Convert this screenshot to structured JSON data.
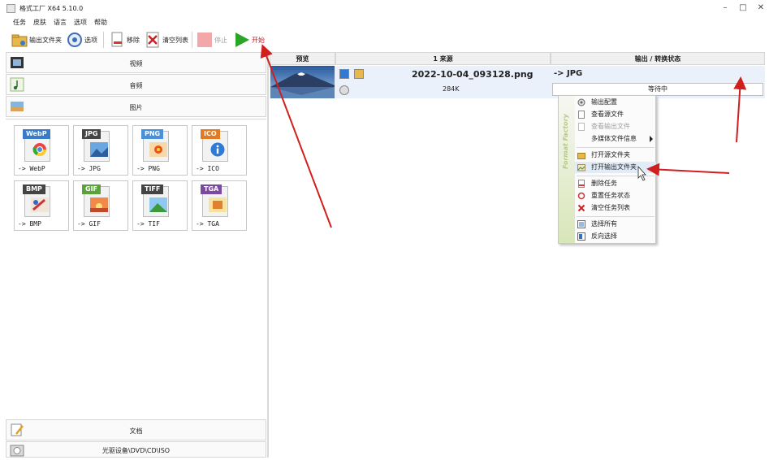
{
  "window": {
    "title": "格式工厂 X64 5.10.0"
  },
  "menu": [
    "任务",
    "皮肤",
    "语言",
    "选项",
    "帮助"
  ],
  "toolbar": {
    "output_folder": "输出文件夹",
    "options": "选项",
    "remove": "移除",
    "clear_list": "清空列表",
    "stop": "停止",
    "start": "开始"
  },
  "categories": {
    "video": "视频",
    "audio": "音频",
    "image": "图片",
    "document": "文档",
    "disc": "光驱设备\\DVD\\CD\\ISO"
  },
  "formats": [
    {
      "badge": "WebP",
      "label": "-> WebP",
      "color": "#3a7bc8"
    },
    {
      "badge": "JPG",
      "label": "-> JPG",
      "color": "#444444"
    },
    {
      "badge": "PNG",
      "label": "-> PNG",
      "color": "#4a90d9"
    },
    {
      "badge": "ICO",
      "label": "-> ICO",
      "color": "#e07b24"
    },
    {
      "badge": "BMP",
      "label": "-> BMP",
      "color": "#444444"
    },
    {
      "badge": "GIF",
      "label": "-> GIF",
      "color": "#5aa23a"
    },
    {
      "badge": "TIFF",
      "label": "-> TIF",
      "color": "#444444"
    },
    {
      "badge": "TGA",
      "label": "-> TGA",
      "color": "#7a4aa0"
    }
  ],
  "table": {
    "headers": {
      "preview": "预览",
      "source": "1 来源",
      "output": "输出 / 转换状态"
    },
    "row": {
      "filename": "2022-10-04_093128.png",
      "size": "284K",
      "output_format": "-> JPG",
      "status": "等待中"
    }
  },
  "context_menu": {
    "brand": "Format Factory",
    "items": [
      {
        "label": "输出配置",
        "disabled": false
      },
      {
        "label": "查看源文件",
        "disabled": false
      },
      {
        "label": "查看输出文件",
        "disabled": true
      },
      {
        "label": "多媒体文件信息",
        "disabled": false
      },
      {
        "label": "打开源文件夹",
        "disabled": false
      },
      {
        "label": "打开输出文件夹",
        "disabled": false
      },
      {
        "label": "删除任务",
        "disabled": false
      },
      {
        "label": "重置任务状态",
        "disabled": false
      },
      {
        "label": "清空任务列表",
        "disabled": false
      },
      {
        "label": "选择所有",
        "disabled": false
      },
      {
        "label": "反向选择",
        "disabled": false
      }
    ]
  },
  "colors": {
    "accent_arrow": "#d01f1f",
    "selection": "#eaf1fb",
    "start_green": "#2aa52a"
  }
}
